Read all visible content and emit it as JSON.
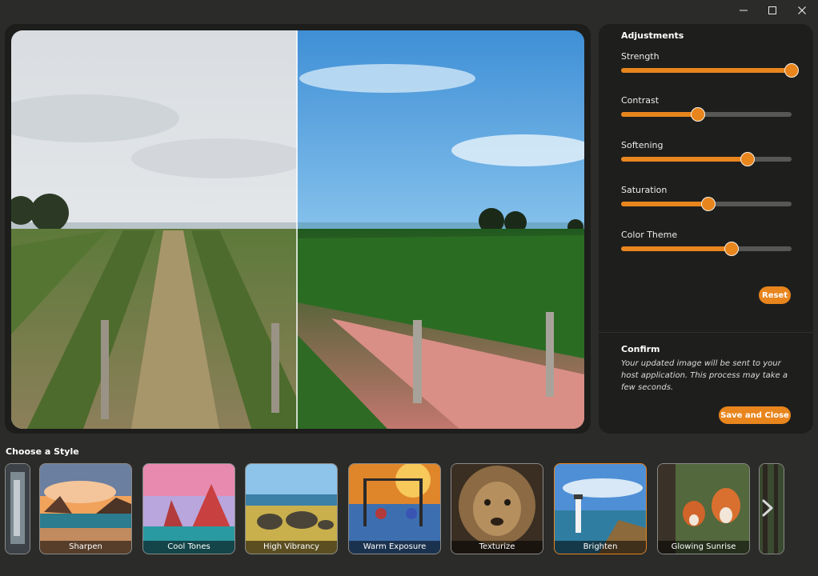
{
  "window": {
    "minimize_icon": "minimize-icon",
    "maximize_icon": "maximize-icon",
    "close_icon": "close-icon"
  },
  "preview": {
    "mode": "before-after split comparison",
    "left_side": "original",
    "right_side": "styled"
  },
  "adjustments": {
    "title": "Adjustments",
    "sliders": [
      {
        "label": "Strength",
        "value": 1.0
      },
      {
        "label": "Contrast",
        "value": 0.45
      },
      {
        "label": "Softening",
        "value": 0.74
      },
      {
        "label": "Saturation",
        "value": 0.51
      },
      {
        "label": "Color Theme",
        "value": 0.65
      }
    ],
    "reset_label": "Reset"
  },
  "confirm": {
    "title": "Confirm",
    "text": "Your updated image will be sent to your host application. This process may take a few seconds.",
    "save_label": "Save and Close"
  },
  "styles": {
    "title": "Choose a Style",
    "items": [
      {
        "label": "Sharpen",
        "selected": false
      },
      {
        "label": "Cool Tones",
        "selected": false
      },
      {
        "label": "High Vibrancy",
        "selected": false
      },
      {
        "label": "Warm Exposure",
        "selected": false
      },
      {
        "label": "Texturize",
        "selected": false
      },
      {
        "label": "Brighten",
        "selected": true
      },
      {
        "label": "Glowing Sunrise",
        "selected": false
      }
    ],
    "next_icon": "chevron-right-icon"
  },
  "colors": {
    "accent": "#e8851d",
    "background": "#2b2b29",
    "panel": "#1e1e1d",
    "track": "#575755"
  }
}
